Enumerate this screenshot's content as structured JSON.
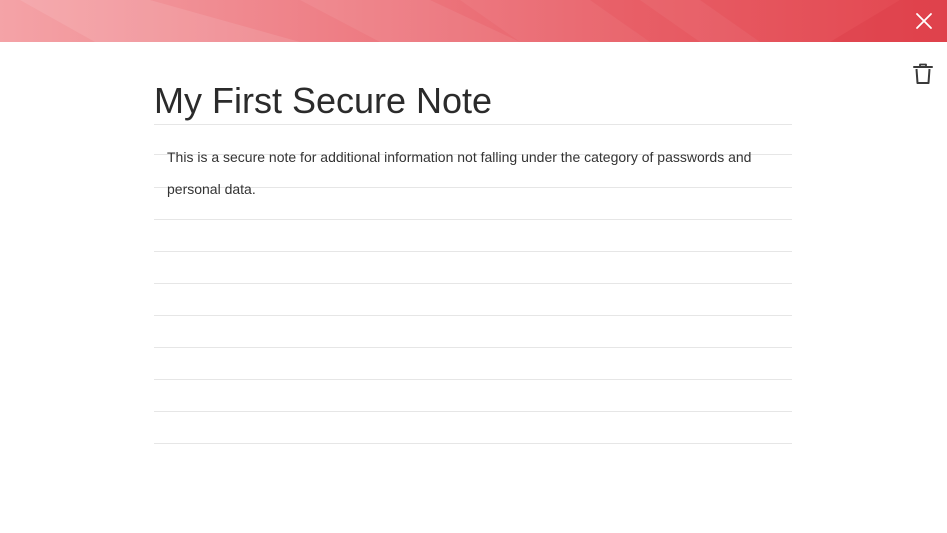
{
  "header": {
    "close_icon": "close-icon",
    "accent_colors": [
      "#f4a3a7",
      "#ee7f86",
      "#e86068",
      "#e2464f"
    ]
  },
  "toolbar": {
    "delete_icon": "trash-icon"
  },
  "note": {
    "title": "My First Secure Note",
    "body": "This is a secure note for additional information not falling under the category of passwords and personal data."
  }
}
